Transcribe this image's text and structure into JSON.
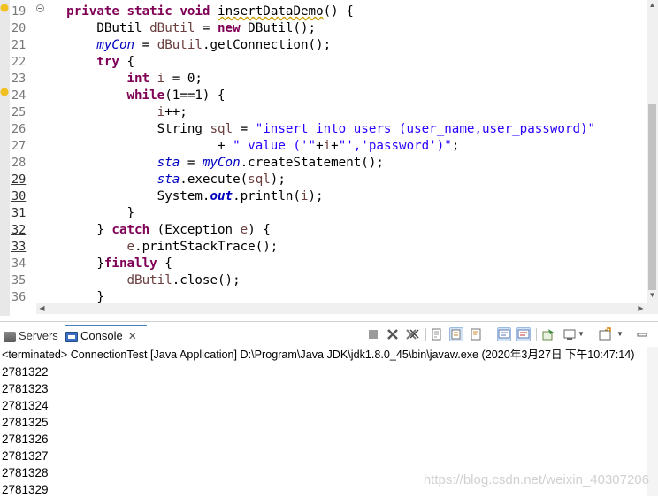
{
  "editor": {
    "line_numbers": [
      "19",
      "20",
      "21",
      "22",
      "23",
      "24",
      "25",
      "26",
      "27",
      "28",
      "29",
      "30",
      "31",
      "32",
      "33",
      "34",
      "35",
      "36"
    ],
    "lines": [
      [
        {
          "t": "    "
        },
        {
          "t": "private",
          "c": "kw"
        },
        {
          "t": " "
        },
        {
          "t": "static",
          "c": "kw"
        },
        {
          "t": " "
        },
        {
          "t": "void",
          "c": "kw"
        },
        {
          "t": " "
        },
        {
          "t": "insertDataDemo",
          "c": "ul-warn"
        },
        {
          "t": "() {"
        }
      ],
      [
        {
          "t": "        DButil "
        },
        {
          "t": "dButil",
          "c": "var"
        },
        {
          "t": " = "
        },
        {
          "t": "new",
          "c": "kw"
        },
        {
          "t": " DButil();"
        }
      ],
      [
        {
          "t": "        "
        },
        {
          "t": "myCon",
          "c": "fld"
        },
        {
          "t": " = "
        },
        {
          "t": "dButil",
          "c": "var"
        },
        {
          "t": ".getConnection();"
        }
      ],
      [
        {
          "t": "        "
        },
        {
          "t": "try",
          "c": "kw"
        },
        {
          "t": " {"
        }
      ],
      [
        {
          "t": "            "
        },
        {
          "t": "int",
          "c": "kw"
        },
        {
          "t": " "
        },
        {
          "t": "i",
          "c": "var"
        },
        {
          "t": " = 0;"
        }
      ],
      [
        {
          "t": "            "
        },
        {
          "t": "while",
          "c": "kw"
        },
        {
          "t": "(1==1) {"
        }
      ],
      [
        {
          "t": "                "
        },
        {
          "t": "i",
          "c": "var"
        },
        {
          "t": "++;"
        }
      ],
      [
        {
          "t": "                String "
        },
        {
          "t": "sql",
          "c": "var"
        },
        {
          "t": " = "
        },
        {
          "t": "\"insert into users (user_name,user_password)\"",
          "c": "str"
        }
      ],
      [
        {
          "t": "                        + "
        },
        {
          "t": "\" value ('\"",
          "c": "str"
        },
        {
          "t": "+"
        },
        {
          "t": "i",
          "c": "var"
        },
        {
          "t": "+"
        },
        {
          "t": "\"','password')\"",
          "c": "str"
        },
        {
          "t": ";"
        }
      ],
      [
        {
          "t": "                "
        },
        {
          "t": "sta",
          "c": "fld"
        },
        {
          "t": " = "
        },
        {
          "t": "myCon",
          "c": "fld"
        },
        {
          "t": ".createStatement();"
        }
      ],
      [
        {
          "t": "                "
        },
        {
          "t": "sta",
          "c": "fld"
        },
        {
          "t": ".execute("
        },
        {
          "t": "sql",
          "c": "var"
        },
        {
          "t": ");"
        }
      ],
      [
        {
          "t": "                System."
        },
        {
          "t": "out",
          "c": "fld-b"
        },
        {
          "t": ".println("
        },
        {
          "t": "i",
          "c": "var"
        },
        {
          "t": ");"
        }
      ],
      [
        {
          "t": "            }"
        }
      ],
      [
        {
          "t": "        } "
        },
        {
          "t": "catch",
          "c": "kw"
        },
        {
          "t": " (Exception "
        },
        {
          "t": "e",
          "c": "var"
        },
        {
          "t": ") {"
        }
      ],
      [
        {
          "t": "            "
        },
        {
          "t": "e",
          "c": "var"
        },
        {
          "t": ".printStackTrace();"
        }
      ],
      [
        {
          "t": "        }"
        },
        {
          "t": "finally",
          "c": "kw"
        },
        {
          "t": " {"
        }
      ],
      [
        {
          "t": "            "
        },
        {
          "t": "dButil",
          "c": "var"
        },
        {
          "t": ".close();"
        }
      ],
      [
        {
          "t": "        }"
        }
      ]
    ]
  },
  "console_view": {
    "tabs": [
      {
        "label": "Servers",
        "icon": "servers-icon"
      },
      {
        "label": "Console",
        "icon": "console-icon",
        "close": "✕"
      }
    ],
    "status": "<terminated> ConnectionTest [Java Application] D:\\Program\\Java JDK\\jdk1.8.0_45\\bin\\javaw.exe (2020年3月27日 下午10:47:14)",
    "output": [
      "2781322",
      "2781323",
      "2781324",
      "2781325",
      "2781326",
      "2781327",
      "2781328",
      "2781329"
    ]
  },
  "watermark": "https://blog.csdn.net/weixin_40307206"
}
